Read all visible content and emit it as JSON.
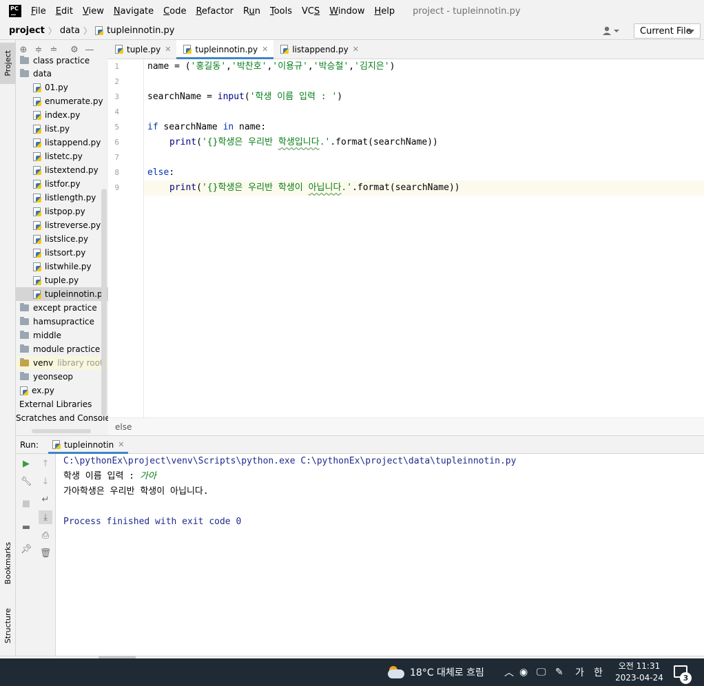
{
  "menubar": {
    "logo": "PC",
    "items": [
      {
        "pre": "",
        "ul": "F",
        "post": "ile"
      },
      {
        "pre": "",
        "ul": "E",
        "post": "dit"
      },
      {
        "pre": "",
        "ul": "V",
        "post": "iew"
      },
      {
        "pre": "",
        "ul": "N",
        "post": "avigate"
      },
      {
        "pre": "",
        "ul": "C",
        "post": "ode"
      },
      {
        "pre": "",
        "ul": "R",
        "post": "efactor"
      },
      {
        "pre": "R",
        "ul": "u",
        "post": "n"
      },
      {
        "pre": "",
        "ul": "T",
        "post": "ools"
      },
      {
        "pre": "VC",
        "ul": "S",
        "post": ""
      },
      {
        "pre": "",
        "ul": "W",
        "post": "indow"
      },
      {
        "pre": "",
        "ul": "H",
        "post": "elp"
      }
    ],
    "window_title": "project - tupleinnotin.py"
  },
  "navbar": {
    "project": "project",
    "folder": "data",
    "file": "tupleinnotin.py",
    "run_config": "Current File"
  },
  "left_stripe": {
    "project": "Project",
    "bookmarks": "Bookmarks",
    "structure": "Structure"
  },
  "tree": {
    "class_practice": "class practice",
    "data": "data",
    "files": [
      "01.py",
      "enumerate.py",
      "index.py",
      "list.py",
      "listappend.py",
      "listetc.py",
      "listextend.py",
      "listfor.py",
      "listlength.py",
      "listpop.py",
      "listreverse.py",
      "listslice.py",
      "listsort.py",
      "listwhile.py",
      "tuple.py",
      "tupleinnotin.py"
    ],
    "folders": [
      "except practice",
      "hamsupractice",
      "middle",
      "module practice"
    ],
    "venv": "venv",
    "venv_note": "library root",
    "yeonseop": "yeonseop",
    "ex_py": "ex.py",
    "external_libraries": "External Libraries",
    "scratches": "Scratches and Consoles"
  },
  "editor_tabs": [
    {
      "label": "tuple.py"
    },
    {
      "label": "tupleinnotin.py"
    },
    {
      "label": "listappend.py"
    }
  ],
  "code": {
    "line_numbers": [
      "1",
      "2",
      "3",
      "4",
      "5",
      "6",
      "7",
      "8",
      "9"
    ],
    "l1_a": "name = (",
    "l1_s1": "'홍길동'",
    "l1_s2": "'박찬호'",
    "l1_s3": "'이용규'",
    "l1_s4": "'박승철'",
    "l1_s5": "'김지은'",
    "l1_comma": ",",
    "l1_end": ")",
    "l3_a": "searchName = ",
    "l3_fn": "input",
    "l3_paren": "(",
    "l3_str": "'학생 이름 입력 : '",
    "l3_end": ")",
    "l5_if": "if",
    "l5_mid": " searchName ",
    "l5_in": "in",
    "l5_end": " name:",
    "l6_print": "print",
    "l6_paren": "(",
    "l6_str_a": "'{}학생은 우리반 ",
    "l6_str_sq": "학생입니다",
    "l6_str_b": ".'",
    "l6_end": ".format(searchName))",
    "l8_else": "else",
    "l8_colon": ":",
    "l9_print": "print",
    "l9_paren": "(",
    "l9_str_a": "'{}학생은 우리반 학생이 ",
    "l9_str_sq": "아닙니다",
    "l9_str_b": ".'",
    "l9_end": ".format(searchName))"
  },
  "breadcrumb_bottom": "else",
  "run": {
    "label": "Run:",
    "tab": "tupleinnotin",
    "lines": {
      "cmd": "C:\\pythonEx\\project\\venv\\Scripts\\python.exe C:\\pythonEx\\project\\data\\tupleinnotin.py",
      "prompt": "학생 이름 입력 : ",
      "input": "가아",
      "result": "가아학생은 우리반 학생이 아닙니다.",
      "exit": "Process finished with exit code 0"
    }
  },
  "taskbar": {
    "weather": "18°C 대체로 흐림",
    "ime": "가",
    "ime2": "한",
    "time": "오전 11:31",
    "date": "2023-04-24",
    "notifications": "3"
  },
  "colors": {
    "accent": "#4083c9",
    "keyword": "#0033b3",
    "string": "#067d17",
    "taskbar": "#1f2a34"
  }
}
